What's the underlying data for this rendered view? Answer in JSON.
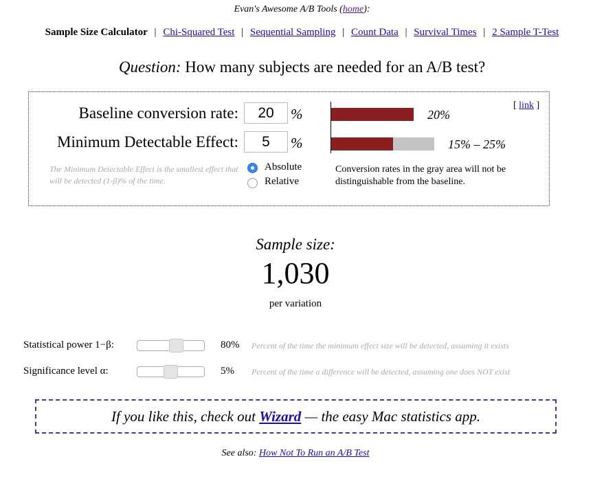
{
  "header": {
    "title_prefix": "Evan's Awesome A/B Tools (",
    "home_link": "home",
    "title_suffix": "):"
  },
  "nav": {
    "current": "Sample Size Calculator",
    "links": [
      "Chi-Squared Test",
      "Sequential Sampling",
      "Count Data",
      "Survival Times",
      "2 Sample T-Test"
    ],
    "separator": "|"
  },
  "question": {
    "label": "Question:",
    "text": "How many subjects are needed for an A/B test?"
  },
  "calculator": {
    "baseline_label": "Baseline conversion rate:",
    "baseline_value": "20",
    "mde_label": "Minimum Detectable Effect:",
    "mde_value": "5",
    "percent_symbol": "%",
    "mde_note": "The Minimum Detectable Effect is the smallest effect that will be detected (1-β)% of the time.",
    "mode_options": [
      {
        "label": "Absolute",
        "selected": true
      },
      {
        "label": "Relative",
        "selected": false
      }
    ],
    "link_open": "[",
    "link_text": "link",
    "link_close": "]",
    "baseline_bar_label": "20%",
    "baseline_bar_fraction": 0.2,
    "range_bar_label": "15% – 25%",
    "range_low_fraction": 0.15,
    "range_high_fraction": 0.25,
    "explanation": "Conversion rates in the gray area will not be distinguishable from the baseline.",
    "colors": {
      "bar": "#8b1f1f",
      "range": "#c4c4c4"
    }
  },
  "result": {
    "label": "Sample size:",
    "value": "1,030",
    "unit": "per variation"
  },
  "settings": {
    "power_label": "Statistical power 1−β:",
    "power_value": "80%",
    "power_level": 0.8,
    "power_desc": "Percent of the time the minimum effect size will be detected, assuming it exists",
    "significance_label": "Significance level α:",
    "significance_value": "5%",
    "significance_level": 0.05,
    "significance_desc": "Percent of the time a difference will be detected, assuming one does NOT exist"
  },
  "promo": {
    "prefix": "If you like this, check out",
    "link": "Wizard",
    "suffix": "— the easy Mac statistics app."
  },
  "footer": {
    "prefix": "See also:",
    "link": "How Not To Run an A/B Test"
  }
}
